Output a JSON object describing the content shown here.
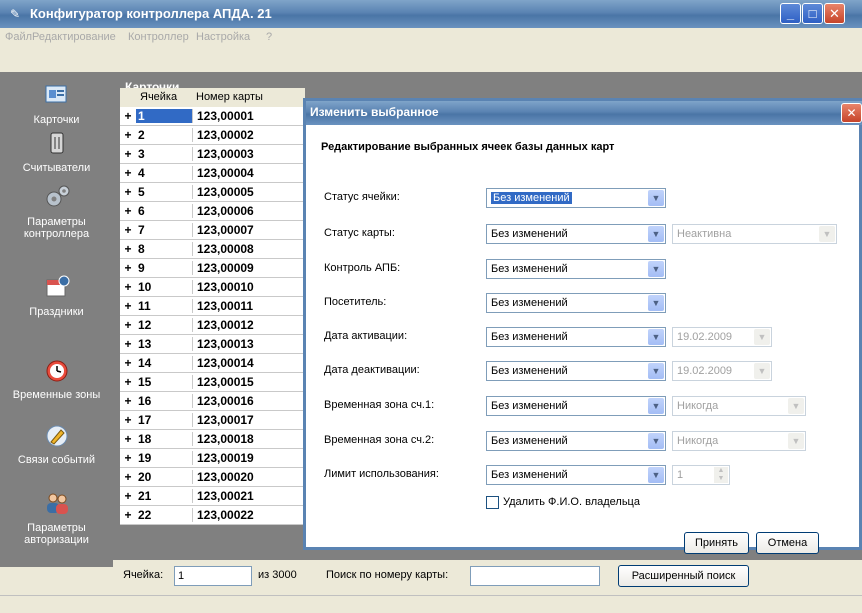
{
  "window": {
    "title": "Конфигуратор контроллера АПДА. 21",
    "minimize": "_",
    "maximize": "□",
    "close": "✕"
  },
  "menu": [
    "Файл",
    "Редактирование",
    "Контроллер",
    "Настройка",
    "?"
  ],
  "sidebar": {
    "items": [
      {
        "label": "Карточки",
        "icon": "cards-icon"
      },
      {
        "label": "Считыватели",
        "icon": "reader-icon"
      },
      {
        "label": "Параметры контроллера",
        "icon": "gears-icon"
      },
      {
        "label": "Праздники",
        "icon": "calendar-icon"
      },
      {
        "label": "Временные зоны",
        "icon": "alarm-clock-icon"
      },
      {
        "label": "Связи событий",
        "icon": "pencil-icon"
      },
      {
        "label": "Параметры авторизации",
        "icon": "users-icon"
      }
    ]
  },
  "cards": {
    "header": "Карточки",
    "columns": [
      "Ячейка",
      "Номер карты"
    ],
    "rows": [
      {
        "cell": "1",
        "card": "123,00001"
      },
      {
        "cell": "2",
        "card": "123,00002"
      },
      {
        "cell": "3",
        "card": "123,00003"
      },
      {
        "cell": "4",
        "card": "123,00004"
      },
      {
        "cell": "5",
        "card": "123,00005"
      },
      {
        "cell": "6",
        "card": "123,00006"
      },
      {
        "cell": "7",
        "card": "123,00007"
      },
      {
        "cell": "8",
        "card": "123,00008"
      },
      {
        "cell": "9",
        "card": "123,00009"
      },
      {
        "cell": "10",
        "card": "123,00010"
      },
      {
        "cell": "11",
        "card": "123,00011"
      },
      {
        "cell": "12",
        "card": "123,00012"
      },
      {
        "cell": "13",
        "card": "123,00013"
      },
      {
        "cell": "14",
        "card": "123,00014"
      },
      {
        "cell": "15",
        "card": "123,00015"
      },
      {
        "cell": "16",
        "card": "123,00016"
      },
      {
        "cell": "17",
        "card": "123,00017"
      },
      {
        "cell": "18",
        "card": "123,00018"
      },
      {
        "cell": "19",
        "card": "123,00019"
      },
      {
        "cell": "20",
        "card": "123,00020"
      },
      {
        "cell": "21",
        "card": "123,00021"
      },
      {
        "cell": "22",
        "card": "123,00022"
      }
    ],
    "expand_glyph": "+"
  },
  "bottom": {
    "cell_label": "Ячейка:",
    "cell_value": "1",
    "of_total": "из 3000",
    "search_label": "Поиск по номеру карты:",
    "search_value": "",
    "advanced_search": "Расширенный поиск"
  },
  "dialog": {
    "title": "Изменить выбранное",
    "heading": "Редактирование выбранных ячеек базы данных карт",
    "fields": [
      {
        "label": "Статус ячейки:",
        "value": "Без изменений",
        "extra": null
      },
      {
        "label": "Статус карты:",
        "value": "Без изменений",
        "extra": "Неактивна"
      },
      {
        "label": "Контроль АПБ:",
        "value": "Без изменений",
        "extra": null
      },
      {
        "label": "Посетитель:",
        "value": "Без изменений",
        "extra": null
      },
      {
        "label": "Дата активации:",
        "value": "Без изменений",
        "extra": "19.02.2009"
      },
      {
        "label": "Дата деактивации:",
        "value": "Без изменений",
        "extra": "19.02.2009"
      },
      {
        "label": "Временная зона сч.1:",
        "value": "Без изменений",
        "extra": "Никогда"
      },
      {
        "label": "Временная зона сч.2:",
        "value": "Без изменений",
        "extra": "Никогда"
      },
      {
        "label": "Лимит использования:",
        "value": "Без изменений",
        "extra": "1"
      }
    ],
    "delete_owner": "Удалить Ф.И.О. владельца",
    "accept": "Принять",
    "cancel": "Отмена"
  }
}
